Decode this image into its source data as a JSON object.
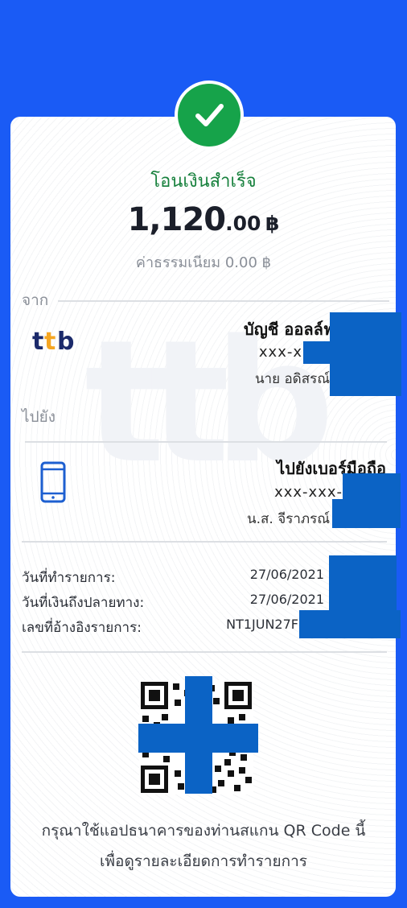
{
  "status_title": "โอนเงินสำเร็จ",
  "amount": {
    "main": "1,120",
    "decimals": ".00",
    "currency": "฿"
  },
  "fee_text": "ค่าธรรมเนียม 0.00 ฿",
  "from": {
    "label": "จาก",
    "bank_logo": "ttb",
    "account_type": "บัญชี ออลล์ฟ",
    "account_number": "xxx-x",
    "account_name": "นาย อดิสรณ์"
  },
  "to": {
    "label": "ไปยัง",
    "icon": "mobile-phone-icon",
    "account_type": "ไปยังเบอร์มือถือ",
    "account_number": "xxx-xxx-",
    "account_name": "น.ส. จีราภรณ์"
  },
  "details": [
    {
      "label": "วันที่ทำรายการ:",
      "value": "27/06/2021"
    },
    {
      "label": "วันที่เงินถึงปลายทาง:",
      "value": "27/06/2021"
    },
    {
      "label": "เลขที่อ้างอิงรายการ:",
      "value": "NT1JUN27F"
    }
  ],
  "footer_line1": "กรุณาใช้แอปธนาคารของท่านสแกน QR Code นี้",
  "footer_line2": "เพื่อดูรายละเอียดการทำรายการ",
  "colors": {
    "background": "#1a5bf5",
    "success": "#16a34a",
    "mask": "#0b63c5",
    "ttb_navy": "#1b2a6b",
    "ttb_orange": "#f5a623"
  }
}
